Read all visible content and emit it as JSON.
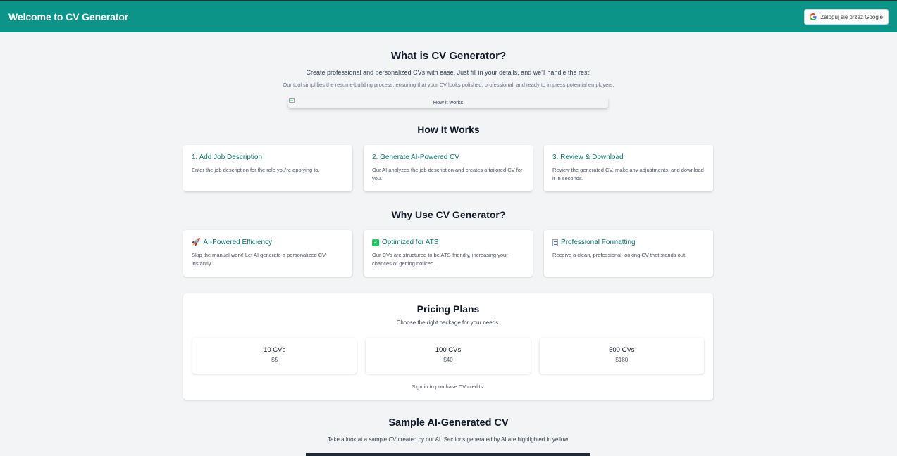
{
  "header": {
    "brand": "Welcome to CV Generator",
    "google_button": "Zaloguj się przez Google",
    "color": "#0d9488"
  },
  "intro": {
    "title": "What is CV Generator?",
    "paragraph1": "Create professional and personalized CVs with ease. Just fill in your details, and we'll handle the rest!",
    "paragraph2": "Our tool simplifies the resume-building process, ensuring that your CV looks polished, professional, and ready to impress potential employers.",
    "image_alt": "How it works"
  },
  "how_it_works": {
    "title": "How It Works",
    "steps": [
      {
        "title": "1. Add Job Description",
        "text": "Enter the job description for the role you're applying to."
      },
      {
        "title": "2. Generate AI-Powered CV",
        "text": "Our AI analyzes the job description and creates a tailored CV for you."
      },
      {
        "title": "3. Review & Download",
        "text": "Review the generated CV, make any adjustments, and download it in seconds."
      }
    ]
  },
  "why_use": {
    "title": "Why Use CV Generator?",
    "features": [
      {
        "icon": "rocket-icon",
        "title": "AI-Powered Efficiency",
        "text": "Skip the manual work! Let AI generate a personalized CV instantly"
      },
      {
        "icon": "check-icon",
        "title": "Optimized for ATS",
        "text": "Our CVs are structured to be ATS-friendly, increasing your chances of getting noticed."
      },
      {
        "icon": "document-icon",
        "title": "Professional Formatting",
        "text": "Receive a clean, professional-looking CV that stands out."
      }
    ]
  },
  "pricing": {
    "title": "Pricing Plans",
    "subtitle": "Choose the right package for your needs.",
    "plans": [
      {
        "name": "10 CVs",
        "price": "$5"
      },
      {
        "name": "100 CVs",
        "price": "$40"
      },
      {
        "name": "500 CVs",
        "price": "$180"
      }
    ],
    "note": "Sign in to purchase CV credits."
  },
  "sample": {
    "title": "Sample AI-Generated CV",
    "subtitle": "Take a look at a sample CV created by our AI. Sections generated by AI are highlighted in yellow."
  },
  "colors": {
    "accent": "#0d9488",
    "card_title": "#0f766e",
    "background": "#f3f4f6"
  }
}
